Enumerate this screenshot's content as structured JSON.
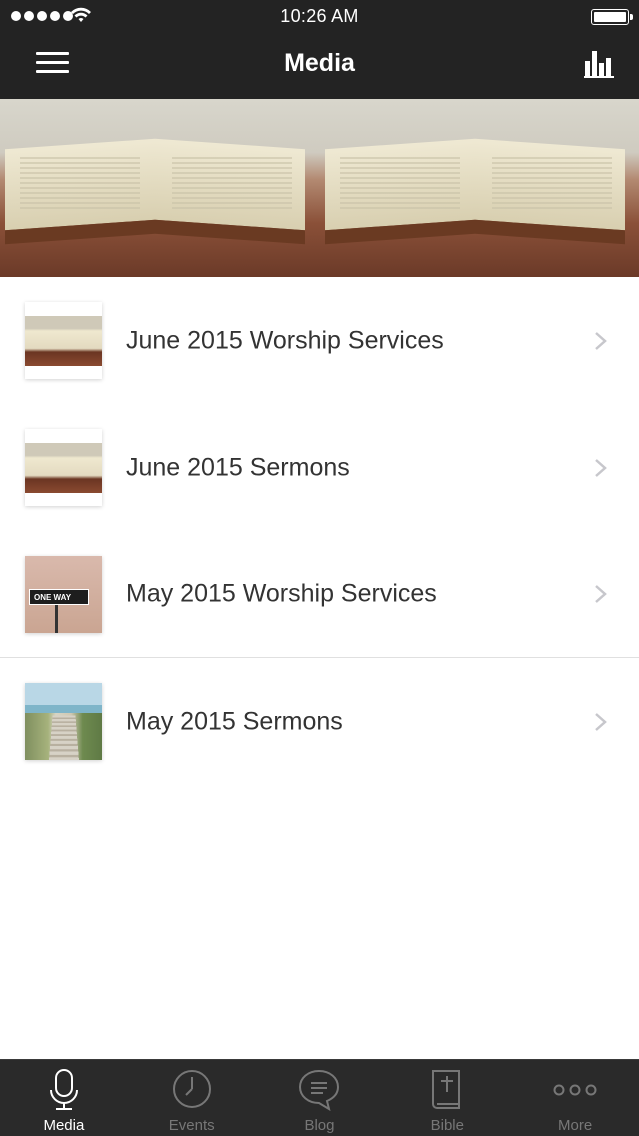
{
  "status_bar": {
    "time": "10:26 AM"
  },
  "nav": {
    "title": "Media"
  },
  "list": {
    "items": [
      {
        "label": "June 2015 Worship Services"
      },
      {
        "label": "June 2015 Sermons"
      },
      {
        "label": "May 2015 Worship Services"
      },
      {
        "label": "May 2015 Sermons"
      }
    ]
  },
  "thumbnails": {
    "sign_text": "ONE WAY"
  },
  "tabbar": {
    "tabs": [
      {
        "label": "Media",
        "icon": "microphone-icon",
        "active": true
      },
      {
        "label": "Events",
        "icon": "clock-icon",
        "active": false
      },
      {
        "label": "Blog",
        "icon": "speech-bubble-icon",
        "active": false
      },
      {
        "label": "Bible",
        "icon": "bible-icon",
        "active": false
      },
      {
        "label": "More",
        "icon": "more-dots-icon",
        "active": false
      }
    ]
  },
  "colors": {
    "bar_background": "#232323",
    "tab_active": "#ffffff",
    "tab_inactive": "#777777",
    "list_text": "#333333"
  }
}
